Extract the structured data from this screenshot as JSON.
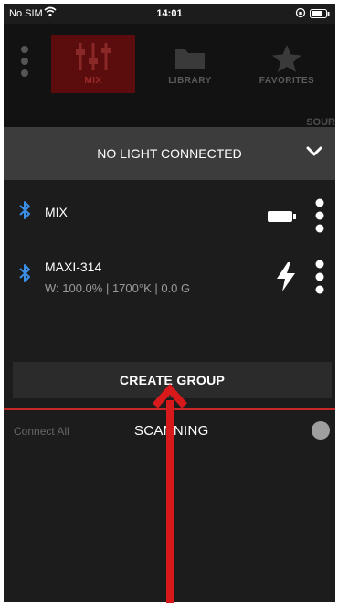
{
  "status_bar": {
    "carrier": "No SIM",
    "time": "14:01"
  },
  "background_app": {
    "tabs": [
      {
        "label": "MIX",
        "icon": "sliders-icon",
        "active": true
      },
      {
        "label": "LIBRARY",
        "icon": "folder-icon",
        "active": false
      },
      {
        "label": "FAVORITES",
        "icon": "star-icon",
        "active": false
      }
    ],
    "partial_label": "SOUR"
  },
  "panel": {
    "title": "NO LIGHT CONNECTED"
  },
  "devices": [
    {
      "name": "MIX",
      "details": "",
      "status_icon": "battery-icon"
    },
    {
      "name": "MAXI-314",
      "details": "W: 100.0% | 1700°K | 0.0 G",
      "status_icon": "lightning-icon"
    }
  ],
  "create_group_label": "CREATE GROUP",
  "connect_all_label": "Connect All",
  "scanning_label": "SCANNING",
  "colors": {
    "accent_red": "#c62727",
    "bluetooth_blue": "#3a8fe8",
    "background": "#1c1c1c",
    "header_gray": "#3c3c3c"
  }
}
